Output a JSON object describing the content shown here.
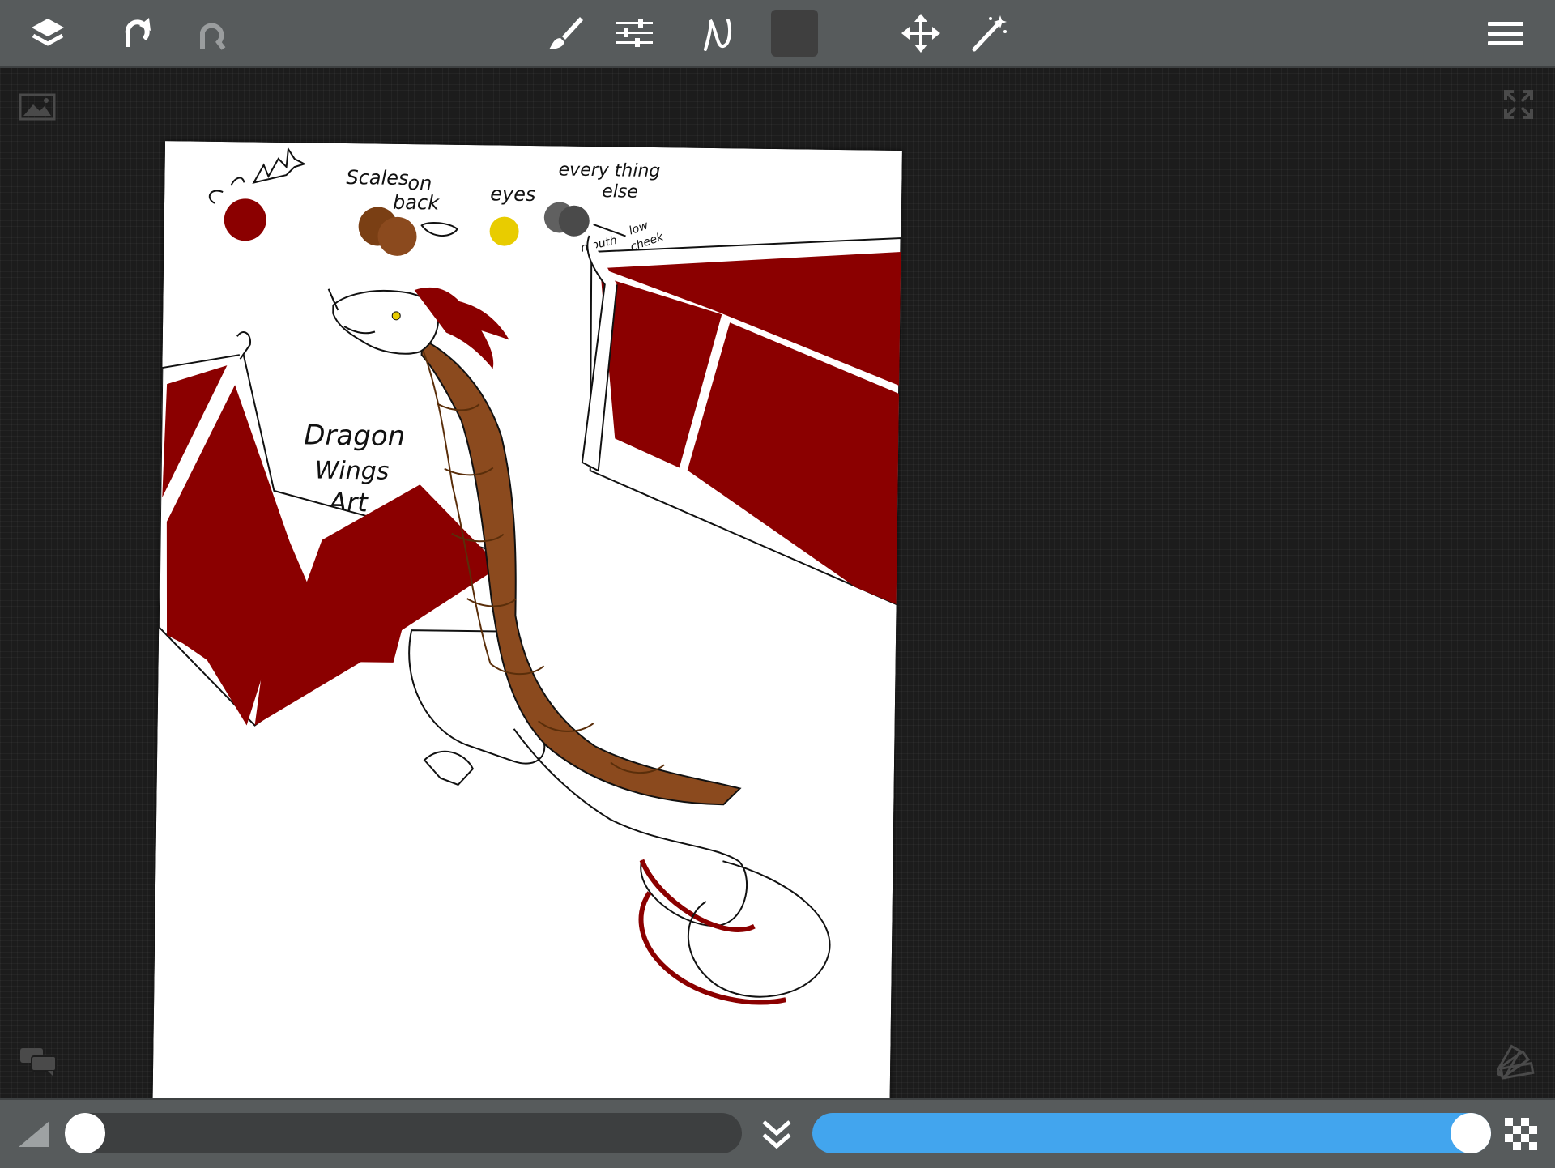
{
  "toolbar": {
    "icons": [
      "layers-icon",
      "undo-icon",
      "redo-icon",
      "brush-icon",
      "adjustments-icon",
      "stroke-icon",
      "color-swatch",
      "move-icon",
      "magic-wand-icon",
      "menu-icon"
    ],
    "current_color": "#3f3f3f",
    "bar_color": "#575b5c"
  },
  "canvas": {
    "labels": {
      "scales": "Scales",
      "on": "on",
      "back": "back",
      "eyes": "eyes",
      "everything": "every thing",
      "else": "else",
      "mouth": "mouth",
      "low": "low",
      "cheek": "cheek",
      "dragon": "Dragon",
      "wings": "Wings",
      "art": "Art"
    },
    "palette": {
      "wing_red": "#8b0000",
      "scale_brown": "#8b4a1e",
      "scale_brown_dark": "#7a3f14",
      "eye_yellow": "#e8cc00",
      "grey_dark": "#4a4a4a",
      "grey_mid": "#606060"
    }
  },
  "bottombar": {
    "brush_size": 0.0,
    "opacity": 1.0,
    "slider_color": "#42a5ee"
  }
}
